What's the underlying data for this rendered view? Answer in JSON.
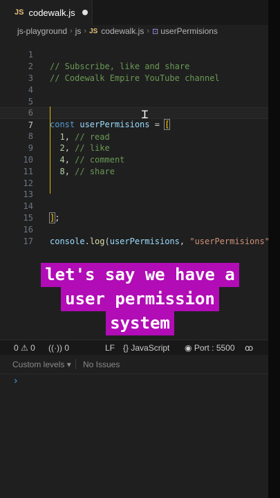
{
  "tab": {
    "badge": "JS",
    "filename": "codewalk.js"
  },
  "breadcrumb": {
    "folder": "js-playground",
    "subfolder": "js",
    "file_badge": "JS",
    "file": "codewalk.js",
    "symbol": "userPermisions"
  },
  "editor": {
    "line_numbers": [
      "1",
      "2",
      "3",
      "4",
      "5",
      "6",
      "7",
      "8",
      "9",
      "10",
      "11",
      "12",
      "13",
      "14",
      "15",
      "16",
      "17"
    ],
    "lines": {
      "l1": "// Subscribe, like and share",
      "l2": "// Codewalk Empire YouTube channel",
      "l6_kw": "const",
      "l6_var": "userPermisions",
      "l6_op": " = ",
      "l6_br": "[",
      "l7_num": "1",
      "l7_comment": "// read",
      "l8_num": "2",
      "l8_comment": "// like",
      "l9_num": "4",
      "l9_comment": "// comment",
      "l10_num": "8",
      "l10_comment": "// share",
      "l14_br": "]",
      "l14_semi": ";",
      "l16_obj": "console",
      "l16_fn": "log",
      "l16_arg": "userPermisions",
      "l16_str": "\"userPermisions\"",
      "l16_tail": ");"
    }
  },
  "caption": {
    "line1": "let's say we have a",
    "line2": "user permission",
    "line3": "system"
  },
  "statusbar": {
    "errors": "0",
    "warnings": "0",
    "ports": "0",
    "eol": "LF",
    "language": "JavaScript",
    "port": "Port : 5500"
  },
  "panel": {
    "levels": "Custom levels",
    "issues": "No Issues",
    "prompt": "›"
  },
  "colors": {
    "caption_bg": "#b10cb6",
    "comment": "#6a9955",
    "keyword": "#569cd6",
    "variable": "#9cdcfe",
    "string": "#ce9178",
    "number": "#b5cea8"
  }
}
